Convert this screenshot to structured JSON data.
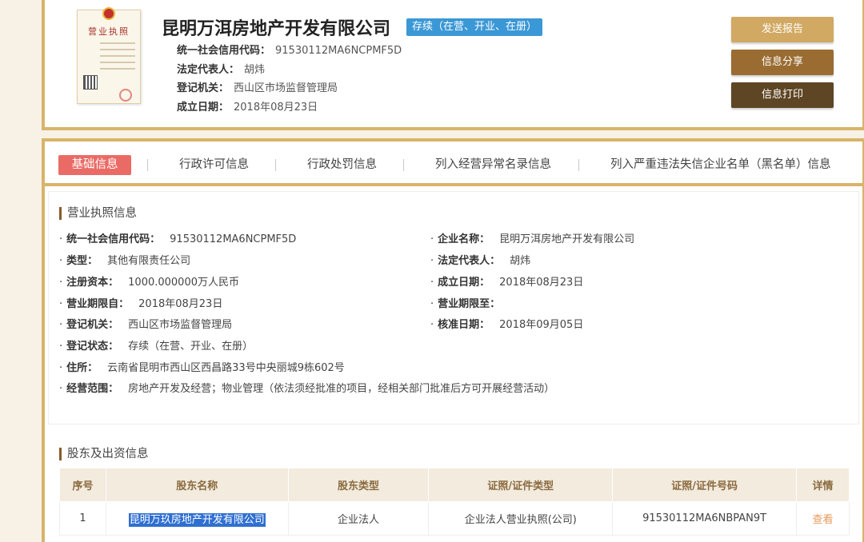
{
  "company": {
    "name": "昆明万洱房地产开发有限公司",
    "status_badge": "存续（在营、开业、在册）",
    "license_thumb_title": "营业执照",
    "fields": [
      {
        "label": "统一社会信用代码：",
        "value": "91530112MA6NCPMF5D"
      },
      {
        "label": "法定代表人：",
        "value": "胡炜"
      },
      {
        "label": "登记机关：",
        "value": "西山区市场监督管理局"
      },
      {
        "label": "成立日期：",
        "value": "2018年08月23日"
      }
    ]
  },
  "actions": {
    "send_report": "发送报告",
    "share": "信息分享",
    "print": "信息打印"
  },
  "tabs": [
    {
      "label": "基础信息",
      "active": true
    },
    {
      "label": "行政许可信息"
    },
    {
      "label": "行政处罚信息"
    },
    {
      "label": "列入经营异常名录信息"
    },
    {
      "label": "列入严重违法失信企业名单（黑名单）信息"
    }
  ],
  "license_info": {
    "title": "营业执照信息",
    "bullet": "·",
    "left": [
      {
        "label": "统一社会信用代码：",
        "value": "91530112MA6NCPMF5D"
      },
      {
        "label": "类型：",
        "value": "其他有限责任公司"
      },
      {
        "label": "注册资本：",
        "value": "1000.000000万人民币"
      },
      {
        "label": "营业期限自：",
        "value": "2018年08月23日"
      },
      {
        "label": "登记机关：",
        "value": "西山区市场监督管理局"
      },
      {
        "label": "登记状态：",
        "value": "存续（在营、开业、在册）"
      },
      {
        "label": "住所：",
        "value": "云南省昆明市西山区西昌路33号中央丽城9栋602号"
      },
      {
        "label": "经营范围：",
        "value": "房地产开发及经营；物业管理（依法须经批准的项目，经相关部门批准后方可开展经营活动）"
      }
    ],
    "right": [
      {
        "label": "企业名称：",
        "value": "昆明万洱房地产开发有限公司"
      },
      {
        "label": "法定代表人：",
        "value": "胡炜"
      },
      {
        "label": "成立日期：",
        "value": "2018年08月23日"
      },
      {
        "label": "营业期限至：",
        "value": ""
      },
      {
        "label": "核准日期：",
        "value": "2018年09月05日"
      }
    ]
  },
  "shareholders": {
    "title": "股东及出资信息",
    "columns": [
      "序号",
      "股东名称",
      "股东类型",
      "证照/证件类型",
      "证照/证件号码",
      "详情"
    ],
    "rows": [
      {
        "index": "1",
        "name": "昆明万玖房地产开发有限公司",
        "type": "企业法人",
        "cert_type": "企业法人营业执照(公司)",
        "cert_no": "91530112MA6NBPAN9T",
        "detail": "查看"
      }
    ]
  },
  "colors": {
    "gold_border": "#d8b46a",
    "active_tab": "#ea6b65",
    "status_badge": "#3b98d6",
    "btn_send": "#d1a962",
    "btn_share": "#9a6c32",
    "btn_print": "#5e4524"
  }
}
